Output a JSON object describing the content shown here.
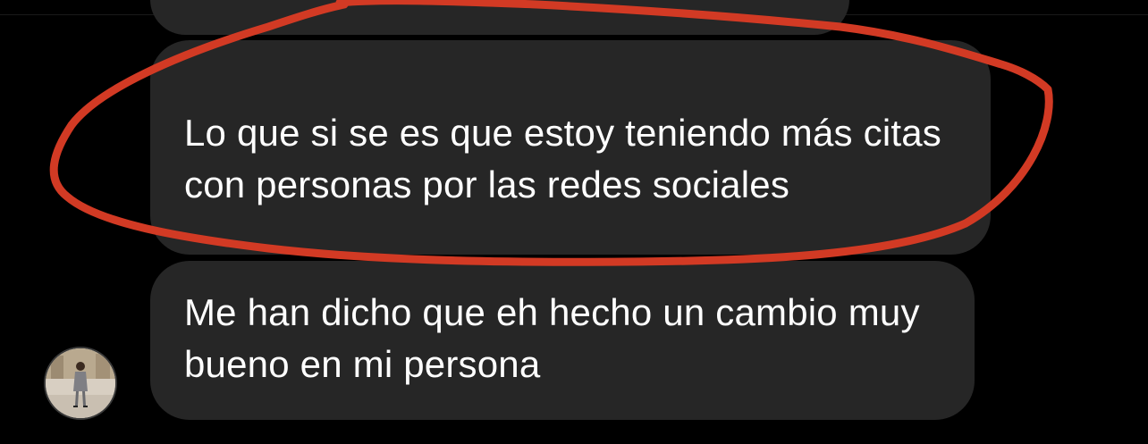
{
  "messages": [
    {
      "text": "Lo que si se es que estoy teniendo más citas con personas por las redes sociales",
      "highlighted": true
    },
    {
      "text": "Me han dicho que eh hecho un cambio muy bueno en mi persona",
      "highlighted": false
    }
  ],
  "colors": {
    "background": "#000000",
    "bubble": "#262626",
    "text": "#ffffff",
    "annotation_stroke": "#d23a24"
  },
  "icons": {
    "avatar": "user-avatar-photo"
  }
}
